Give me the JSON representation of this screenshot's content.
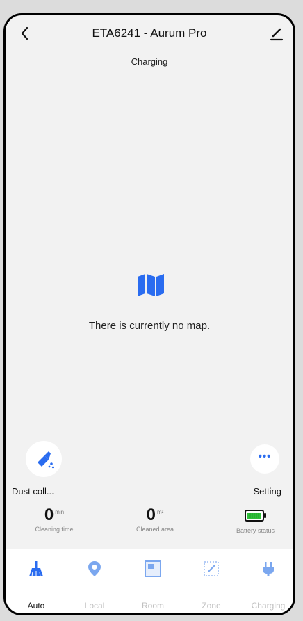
{
  "header": {
    "title": "ETA6241 - Aurum Pro",
    "status": "Charging"
  },
  "map": {
    "empty_message": "There is currently no map."
  },
  "actions": {
    "dust_label": "Dust coll...",
    "setting_label": "Setting",
    "setting_icon_text": "•••"
  },
  "stats": [
    {
      "value": "0",
      "unit": "min",
      "caption": "Cleaning time"
    },
    {
      "value": "0",
      "unit": "m²",
      "caption": "Cleaned area"
    },
    {
      "caption": "Battery status",
      "icon": "battery-full-icon"
    }
  ],
  "tabs": [
    {
      "label": "Auto",
      "icon": "broom-icon",
      "active": true
    },
    {
      "label": "Local",
      "icon": "location-pin-icon",
      "active": false
    },
    {
      "label": "Room",
      "icon": "room-icon",
      "active": false
    },
    {
      "label": "Zone",
      "icon": "zone-icon",
      "active": false
    },
    {
      "label": "Charging",
      "icon": "plug-icon",
      "active": false
    }
  ],
  "colors": {
    "accent": "#2a6cf0",
    "accent_inactive": "#7ba7ef",
    "battery": "#2fbf3a"
  }
}
